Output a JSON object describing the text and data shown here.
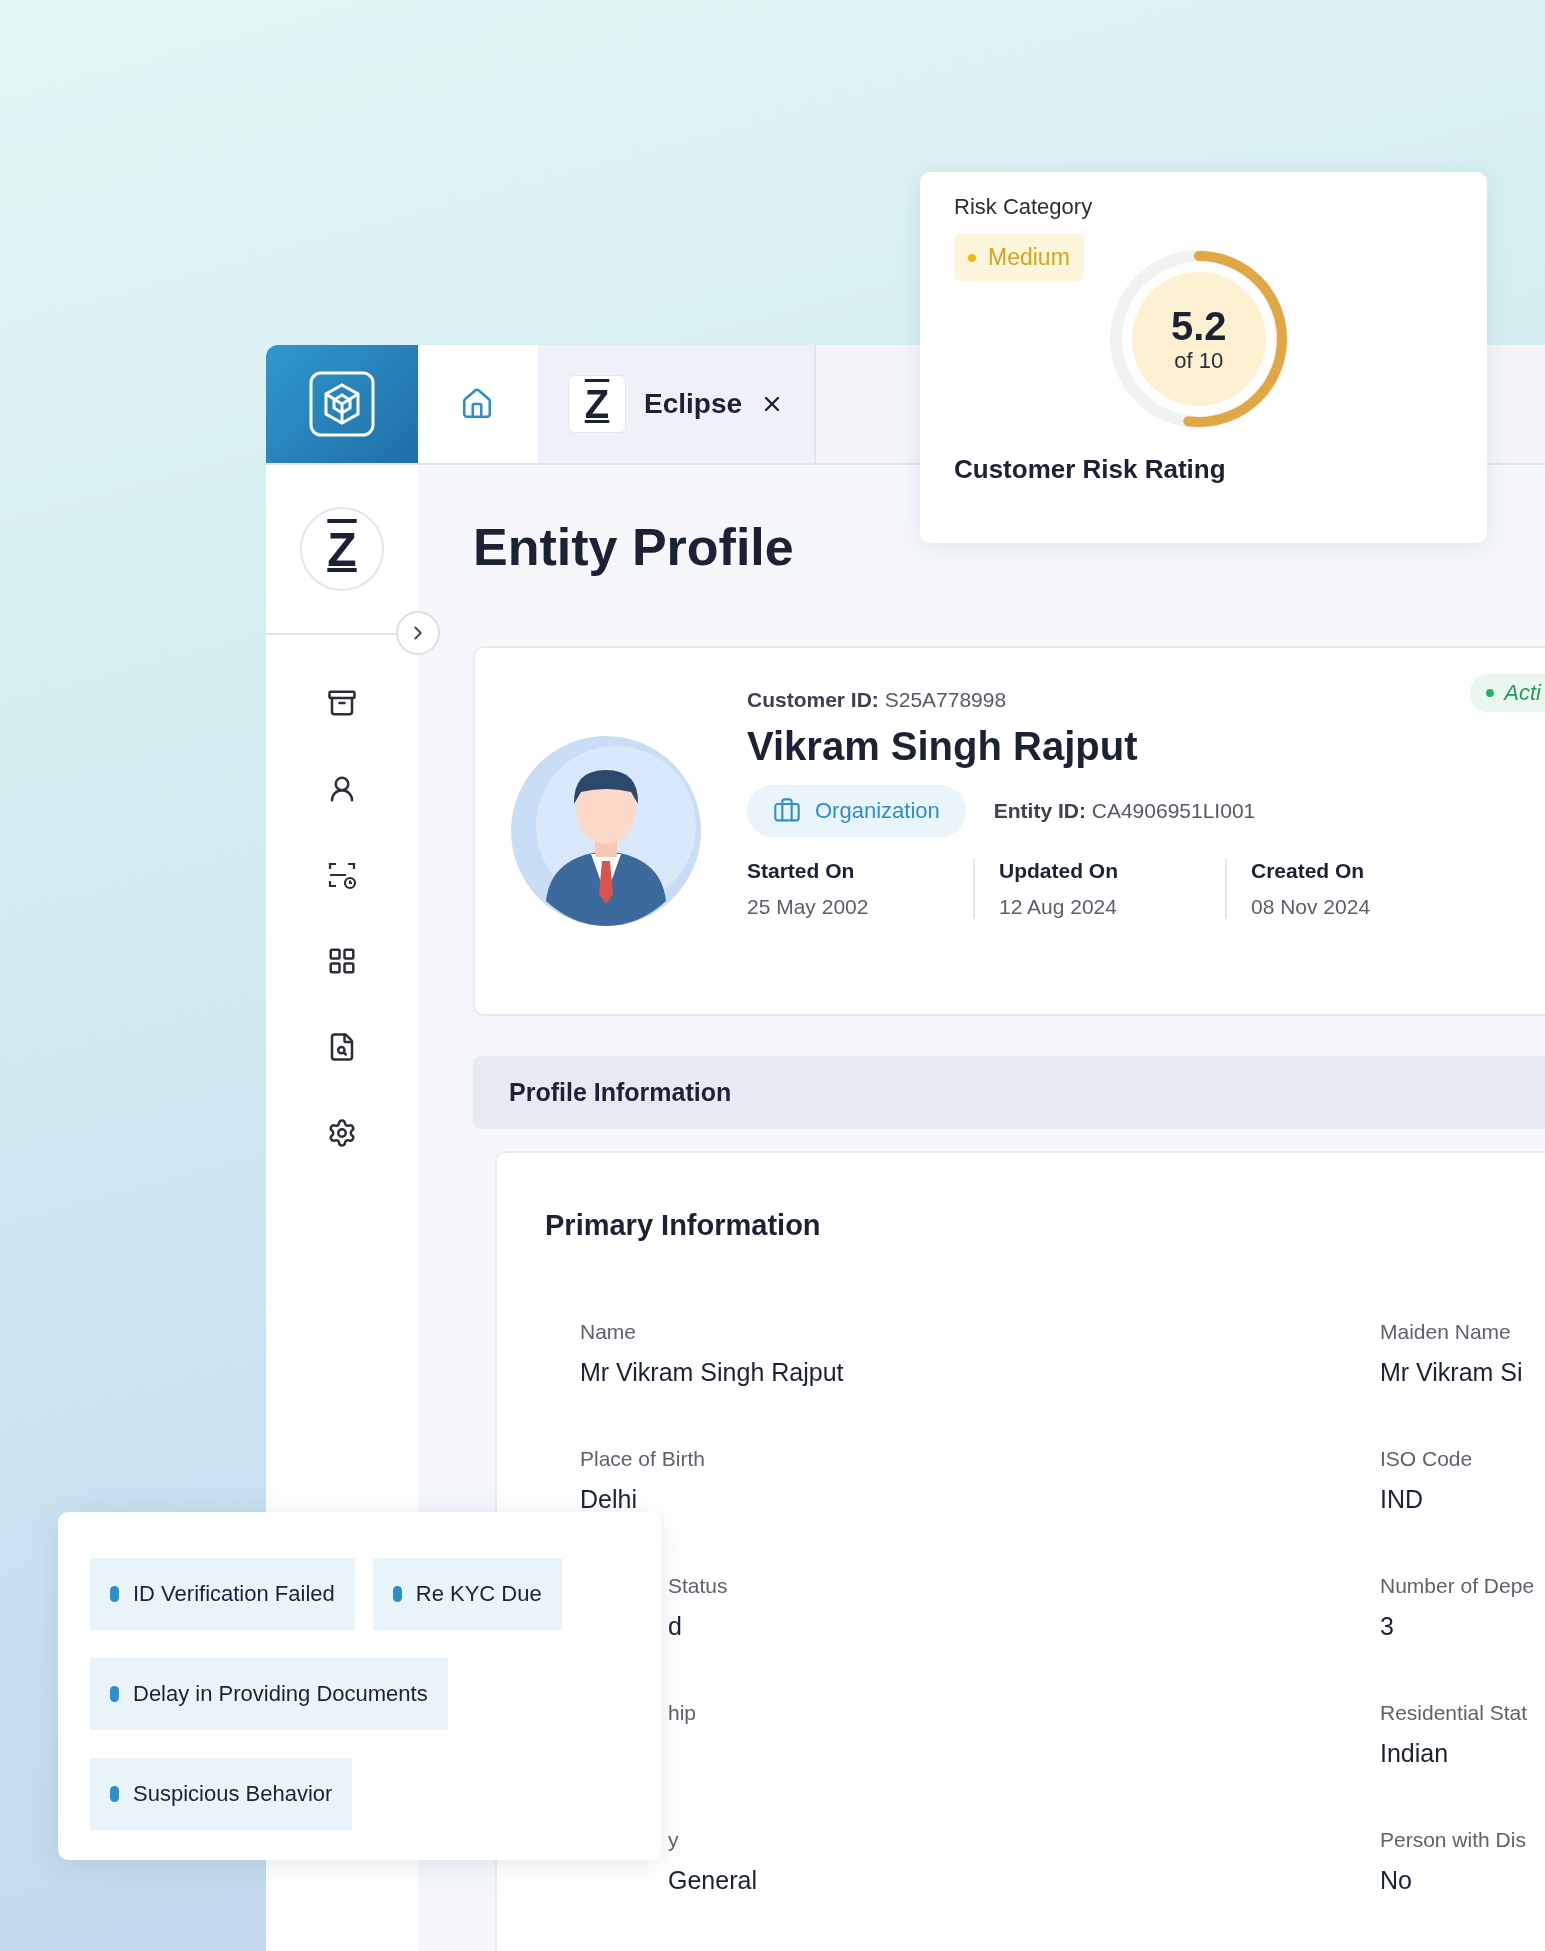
{
  "header": {
    "tabs": [
      {
        "kind": "home",
        "selected": false
      },
      {
        "kind": "entity",
        "logo": "Z",
        "label": "Eclipse",
        "selected": true
      }
    ]
  },
  "sidebar": {
    "logo": "Z",
    "items": [
      {
        "kind": "archive"
      },
      {
        "kind": "user"
      },
      {
        "kind": "scan"
      },
      {
        "kind": "grid"
      },
      {
        "kind": "search-doc"
      },
      {
        "kind": "settings"
      }
    ]
  },
  "page_title": "Entity Profile",
  "profile": {
    "customer_id_label": "Customer ID:",
    "customer_id": "S25A778998",
    "name": "Vikram Singh Rajput",
    "type": "Organization",
    "entity_id_label": "Entity ID:",
    "entity_id": "CA4906951LI001",
    "status": {
      "label": "Acti",
      "color": "#2eb063"
    },
    "dates": [
      {
        "label": "Started On",
        "value": "25 May 2002"
      },
      {
        "label": "Updated On",
        "value": "12 Aug 2024"
      },
      {
        "label": "Created On",
        "value": "08 Nov 2024"
      }
    ]
  },
  "section_title": "Profile Information",
  "primary": {
    "title": "Primary Information",
    "left_fields": [
      {
        "kind": "full",
        "label": "Name",
        "value": "Mr Vikram Singh Rajput"
      },
      {
        "kind": "full",
        "label": "Place of Birth",
        "value": "Delhi"
      },
      {
        "kind": "partial",
        "label": "Status",
        "value": "d"
      },
      {
        "kind": "partial",
        "label": "hip"
      },
      {
        "kind": "partial",
        "label": "y",
        "value": "General"
      }
    ],
    "right_fields": [
      {
        "label": "Maiden Name",
        "value": "Mr Vikram Si"
      },
      {
        "label": "ISO Code",
        "value": "IND"
      },
      {
        "label": "Number of Depe",
        "value": "3"
      },
      {
        "label": "Residential Stat",
        "value": "Indian"
      },
      {
        "label": "Person with Dis",
        "value": "No"
      }
    ]
  },
  "risk": {
    "title": "Risk Category",
    "category": "Medium",
    "score": "5.2",
    "scale": "of 10",
    "level": 0.52,
    "caption": "Customer Risk Rating"
  },
  "alerts": [
    {
      "label": "ID Verification Failed"
    },
    {
      "label": "Re KYC Due"
    },
    {
      "label": "Delay in Providing Documents"
    },
    {
      "label": "Suspicious Behavior"
    }
  ]
}
